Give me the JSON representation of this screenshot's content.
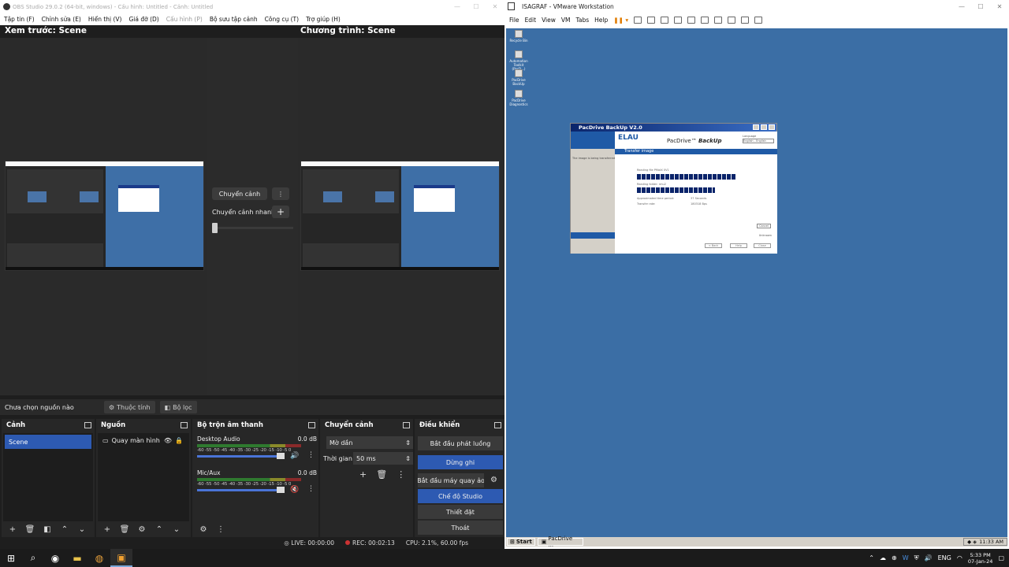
{
  "obs": {
    "title": "OBS Studio 29.0.2 (64-bit, windows) - Cấu hình: Untitled - Cảnh: Untitled",
    "menu": [
      "Tập tin (F)",
      "Chỉnh sửa (E)",
      "Hiển thị (V)",
      "Giá đỡ (D)",
      "Cấu hình (P)",
      "Bộ sưu tập cảnh",
      "Công cụ (T)",
      "Trợ giúp (H)"
    ],
    "preview_title": "Xem trước: Scene",
    "program_title": "Chương trình: Scene",
    "transition_button": "Chuyển cảnh",
    "quick_transitions": "Chuyển cảnh nhanh",
    "no_source_selected": "Chưa chọn nguồn nào",
    "properties_button": "Thuộc tính",
    "filters_button": "Bộ lọc",
    "docks": {
      "scenes": {
        "title": "Cảnh",
        "items": [
          "Scene"
        ]
      },
      "sources": {
        "title": "Nguồn",
        "items": [
          "Quay màn hình"
        ]
      },
      "mixer": {
        "title": "Bộ trộn âm thanh",
        "ticks": "-60 -55 -50 -45 -40 -35 -30 -25 -20 -15 -10 -5 0",
        "channels": [
          {
            "name": "Desktop Audio",
            "db": "0.0 dB",
            "level": 0.92
          },
          {
            "name": "Mic/Aux",
            "db": "0.0 dB",
            "level": 0.92
          }
        ]
      },
      "transitions": {
        "title": "Chuyển cảnh",
        "type": "Mờ dần",
        "duration_label": "Thời gian",
        "duration": "50 ms"
      },
      "controls": {
        "title": "Điều khiển",
        "start_streaming": "Bắt đầu phát luồng",
        "stop_recording": "Dừng ghi",
        "start_virtual_cam": "Bắt đầu máy quay ảo",
        "studio_mode": "Chế độ Studio",
        "settings": "Thiết đặt",
        "exit": "Thoát"
      }
    },
    "status": {
      "live": "LIVE: 00:00:00",
      "rec": "REC: 00:02:13",
      "cpu": "CPU: 2.1%, 60.00 fps"
    }
  },
  "vmware": {
    "title": "ISAGRAF - VMware Workstation",
    "menu": [
      "File",
      "Edit",
      "View",
      "VM",
      "Tabs",
      "Help"
    ],
    "desktop_icons": [
      "Recycle Bin",
      "Automation Toolkit (PacD...)",
      "PacDrive BackUp",
      "PacDrive Diagnostics"
    ],
    "dialog": {
      "title": "PacDrive BackUp V2.0",
      "logo": "ELAU",
      "product": "PacDrive™",
      "product_em": "BackUp",
      "language_label": "Language",
      "language_value": "English - English",
      "section": "Transfer image",
      "left_note": "The image is being transferred",
      "read_label": "Reading file PMotX 0V1",
      "write_label": "Reading folder: rmu2",
      "est_label": "Approximated time period:",
      "est_value": "37 Seconds",
      "rate_label": "Transfer rate:",
      "rate_value": "180318 Bps",
      "progress_1": 0.78,
      "progress_2": 0.62,
      "cancel": "Cancel",
      "status": "Unknown",
      "buttons": [
        "< Back",
        "Help",
        "Close"
      ]
    },
    "guest_taskbar": {
      "start": "Start",
      "task": "PacDrive ...",
      "time": "11:33 AM"
    }
  },
  "windows_taskbar": {
    "lang": "ENG",
    "time": "5:33 PM",
    "date": "07-Jan-24"
  },
  "colors": {
    "obs_blue": "#2d5ab2",
    "guest_desktop": "#3b6ea5"
  }
}
